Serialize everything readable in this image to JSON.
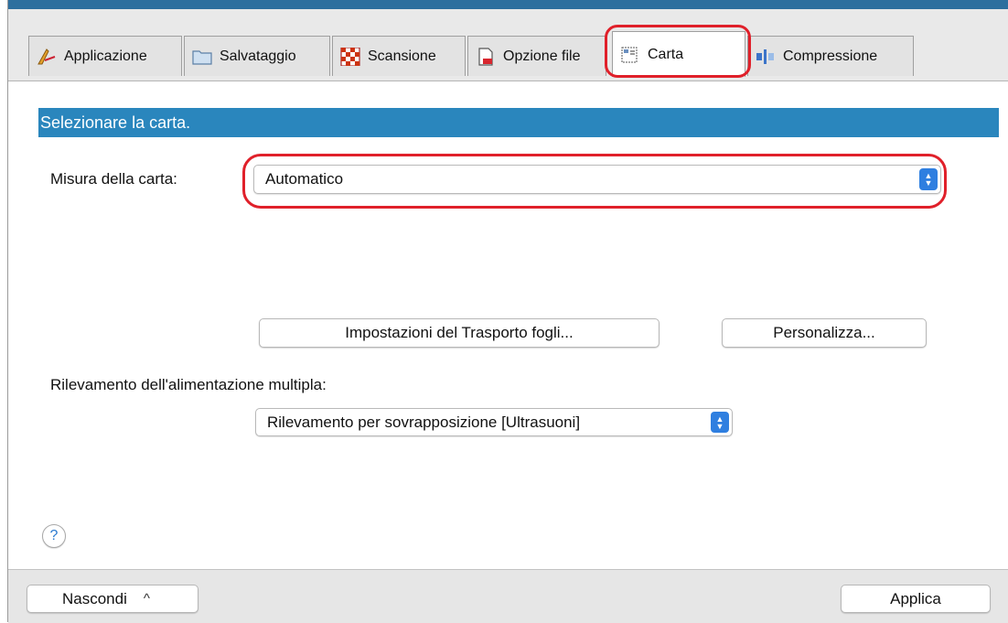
{
  "tabs": [
    {
      "label": "Applicazione",
      "icon": "pen-icon"
    },
    {
      "label": "Salvataggio",
      "icon": "folder-icon"
    },
    {
      "label": "Scansione",
      "icon": "checker-icon"
    },
    {
      "label": "Opzione file",
      "icon": "document-icon"
    },
    {
      "label": "Carta",
      "icon": "paper-icon",
      "active": true
    },
    {
      "label": "Compressione",
      "icon": "compression-icon"
    }
  ],
  "section": {
    "header": "Selezionare la carta."
  },
  "paper_size": {
    "label": "Misura della carta:",
    "value": "Automatico"
  },
  "buttons": {
    "feeder_settings": "Impostazioni del Trasporto fogli...",
    "customize": "Personalizza..."
  },
  "multifeed": {
    "label": "Rilevamento dell'alimentazione multipla:",
    "value": "Rilevamento per sovrapposizione [Ultrasuoni]"
  },
  "help": {
    "glyph": "?"
  },
  "footer": {
    "hide_label": "Nascondi",
    "hide_chevron": "^",
    "apply_label": "Applica"
  },
  "colors": {
    "accent": "#2a86bd",
    "highlight": "#e0202a",
    "select_arrow": "#2f7fe0"
  }
}
